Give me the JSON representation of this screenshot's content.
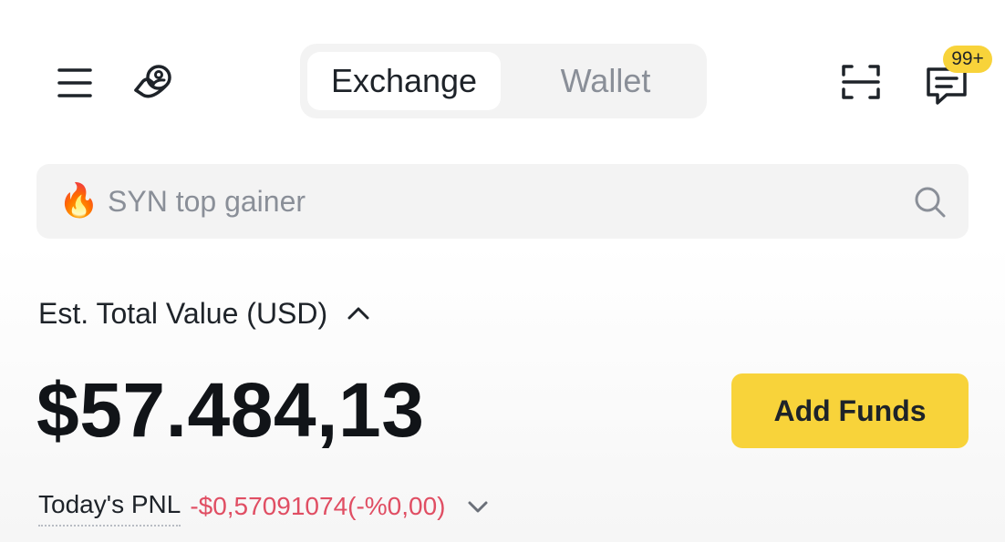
{
  "header": {
    "menu_icon": "hamburger-menu-icon",
    "profile_icon": "profile-icon",
    "tabs": [
      {
        "label": "Exchange",
        "active": true
      },
      {
        "label": "Wallet",
        "active": false
      }
    ],
    "scan_icon": "scan-icon",
    "messages_icon": "message-icon",
    "notification_badge": "99+"
  },
  "search": {
    "emoji": "🔥",
    "placeholder": "SYN top gainer",
    "icon": "search-icon"
  },
  "balance": {
    "label": "Est. Total Value (USD)",
    "value": "$57.484,13",
    "add_funds_label": "Add Funds",
    "pnl_label": "Today's PNL",
    "pnl_value": "-$0,57091074(-%0,00)"
  },
  "colors": {
    "accent_yellow": "#f8d33a",
    "negative_red": "#e04e63",
    "text_primary": "#1e2329",
    "text_muted": "#8a8f98",
    "surface_gray": "#f3f3f3"
  }
}
